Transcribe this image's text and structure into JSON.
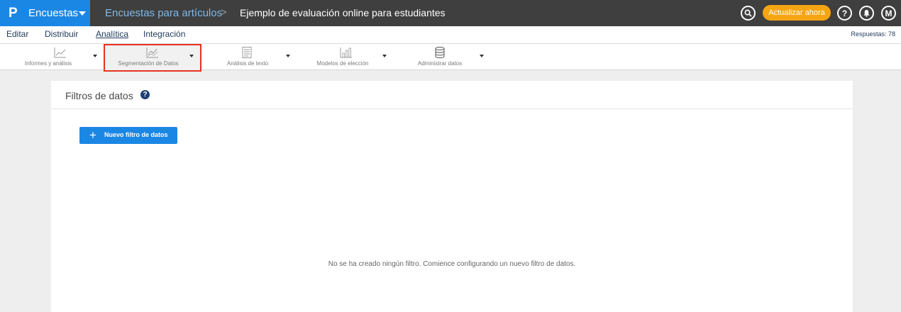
{
  "topbar": {
    "brand_logo": "P",
    "brand_name": "Encuestas",
    "breadcrumb_section": "Encuestas para artículos",
    "breadcrumb_separator": ">",
    "survey_title": "Ejemplo de evaluación online para estudiantes",
    "upgrade_label": "Actualizar ahora",
    "help_glyph": "?",
    "avatar_initial": "M"
  },
  "subnav": {
    "tabs": [
      {
        "label": "Editar"
      },
      {
        "label": "Distribuir"
      },
      {
        "label": "Analítica"
      },
      {
        "label": "Integración"
      }
    ],
    "active_tab": "Analítica",
    "responses": "Respuestas: 78"
  },
  "toolbar": {
    "items": [
      {
        "label": "Informes y análisis",
        "icon": "line-chart-icon"
      },
      {
        "label": "Segmentación de Datos",
        "icon": "segment-chart-icon"
      },
      {
        "label": "Análisis de texto",
        "icon": "text-document-icon"
      },
      {
        "label": "Modelos de elección",
        "icon": "bar-chart-icon"
      },
      {
        "label": "Administrar datos",
        "icon": "database-icon"
      }
    ],
    "selected": "Segmentación de Datos"
  },
  "panel": {
    "title": "Filtros de datos",
    "help_glyph": "?",
    "new_filter_label": "Nuevo filtro de datos",
    "empty_message": "No se ha creado ningún filtro. Comience configurando un nuevo filtro de datos."
  },
  "colors": {
    "brand_blue": "#1b87e5",
    "topbar_bg": "#3f3f3f",
    "upgrade_orange": "#f5a514",
    "highlight_red": "#e8321f",
    "nav_text": "#1f3a5a"
  }
}
